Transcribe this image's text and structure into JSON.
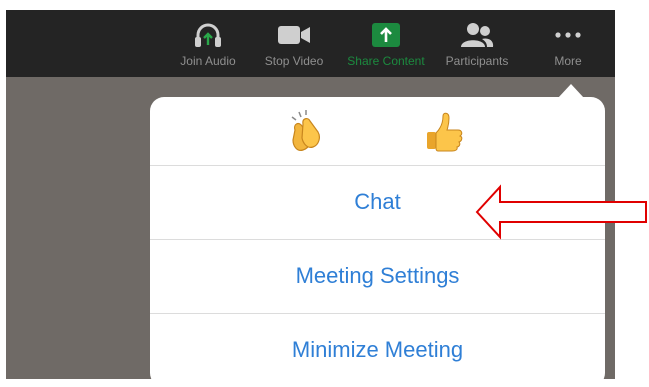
{
  "toolbar": {
    "join_audio": "Join Audio",
    "stop_video": "Stop Video",
    "share_content": "Share Content",
    "participants": "Participants",
    "more": "More"
  },
  "reactions": [
    {
      "icon": "clapping-hands-icon",
      "glyph": "👏"
    },
    {
      "icon": "thumbs-up-icon",
      "glyph": "👍"
    }
  ],
  "menu": {
    "chat": "Chat",
    "meeting_settings": "Meeting Settings",
    "minimize_meeting": "Minimize Meeting"
  },
  "colors": {
    "toolbar_bg": "#242424",
    "share_green": "#1c8a3f",
    "menu_text": "#2f7fd6",
    "annotation_red": "#e00000"
  }
}
